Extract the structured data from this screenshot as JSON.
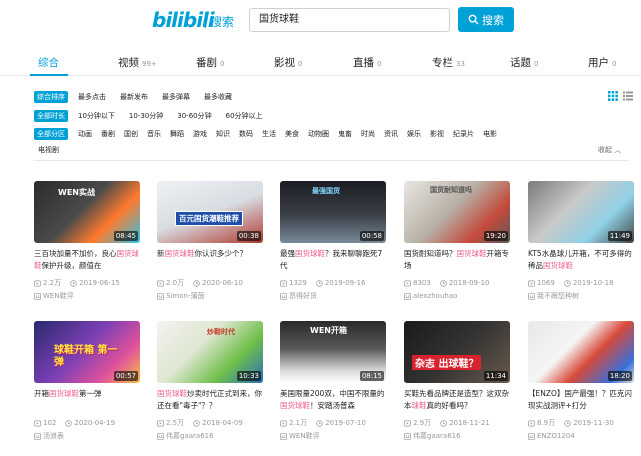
{
  "header": {
    "logo": "bilibili",
    "logo_sub": "搜索",
    "search_value": "国货球鞋",
    "search_button": "搜索"
  },
  "tabs": [
    {
      "label": "综合",
      "count": ""
    },
    {
      "label": "视频",
      "count": "99+"
    },
    {
      "label": "番剧",
      "count": "0"
    },
    {
      "label": "影视",
      "count": "0"
    },
    {
      "label": "直播",
      "count": "0"
    },
    {
      "label": "专栏",
      "count": "33"
    },
    {
      "label": "话题",
      "count": "0"
    },
    {
      "label": "用户",
      "count": "0"
    }
  ],
  "filters": {
    "order": {
      "badge": "综合排序",
      "options": [
        "最多点击",
        "最新发布",
        "最多弹幕",
        "最多收藏"
      ]
    },
    "duration": {
      "badge": "全部时长",
      "options": [
        "10分钟以下",
        "10-30分钟",
        "30-60分钟",
        "60分钟以上"
      ]
    },
    "zone": {
      "badge": "全部分区",
      "options": [
        "动画",
        "番剧",
        "国创",
        "音乐",
        "舞蹈",
        "游戏",
        "知识",
        "数码",
        "生活",
        "美食",
        "动物圈",
        "鬼畜",
        "时尚",
        "资讯",
        "娱乐",
        "影视",
        "纪录片",
        "电影"
      ],
      "overflow": "电视剧"
    },
    "fold": "收起"
  },
  "videos": [
    {
      "title_pre": "三百块加量不加价，良心",
      "title_hl": "国货球鞋",
      "title_post": "保护升级，颜值在",
      "duration": "08:45",
      "plays": "2.2万",
      "date": "2019-06-15",
      "up": "WEN鞋评",
      "overlay": "WEN实战"
    },
    {
      "title_pre": "新",
      "title_hl": "国货球鞋",
      "title_post": "你认识多少个？",
      "duration": "00:38",
      "plays": "2.0万",
      "date": "2020-06-10",
      "up": "Simon-蒲茵",
      "overlay": "百元国货潮鞋推荐"
    },
    {
      "title_pre": "最强",
      "title_hl": "国货球鞋",
      "title_post": "？我来聊聊跑死7代",
      "duration": "00:58",
      "plays": "1329",
      "date": "2019-09-16",
      "up": "昂得好货",
      "overlay": "最强国货"
    },
    {
      "title_pre": "国货耐知道吗？",
      "title_hl": "国货球鞋",
      "title_post": "开箱专场",
      "duration": "19:20",
      "plays": "8303",
      "date": "2018-09-10",
      "up": "alexzhouhao",
      "overlay": "国货耐知道吗"
    },
    {
      "title_pre": "KT5水晶球儿开箱，不可多得的稀品",
      "title_hl": "国货球鞋",
      "title_post": "",
      "duration": "11:49",
      "plays": "1069",
      "date": "2019-10-18",
      "up": "我不跟您种树",
      "overlay": ""
    },
    {
      "title_pre": "开箱",
      "title_hl": "国货球鞋",
      "title_post": "第一弹",
      "duration": "00:57",
      "plays": "102",
      "date": "2020-04-19",
      "up": "汤浪表",
      "overlay": "球鞋开箱 第一弹"
    },
    {
      "title_pre": "",
      "title_hl": "国货球鞋",
      "title_post": "炒卖时代正式到来，你还在看\"毒子\"？？",
      "duration": "10:33",
      "plays": "2.5万",
      "date": "2018-04-09",
      "up": "伟葛gaara616",
      "overlay": "炒鞋时代"
    },
    {
      "title_pre": "美国限量200双，中国不限量的",
      "title_hl": "国货球鞋",
      "title_post": "！安踏汤普森",
      "duration": "08:15",
      "plays": "2.1万",
      "date": "2019-07-10",
      "up": "WEN鞋评",
      "overlay": "WEN开箱"
    },
    {
      "title_pre": "买鞋先看品牌还是造型？这双杂本",
      "title_hl": "球鞋",
      "title_post": "真的好看吗？",
      "duration": "11:34",
      "plays": "2.9万",
      "date": "2018-11-21",
      "up": "伟葛gaara616",
      "overlay": "杂志 出球鞋？"
    },
    {
      "title_pre": "【ENZO】国产最强！？匹克闪现实战测评+打分",
      "title_hl": "",
      "title_post": "",
      "duration": "18:20",
      "plays": "8.9万",
      "date": "2019-11-30",
      "up": "ENZO1204",
      "overlay": ""
    }
  ],
  "colors": {
    "accent": "#00a1d6",
    "highlight": "#f25d8e",
    "muted": "#999999"
  }
}
